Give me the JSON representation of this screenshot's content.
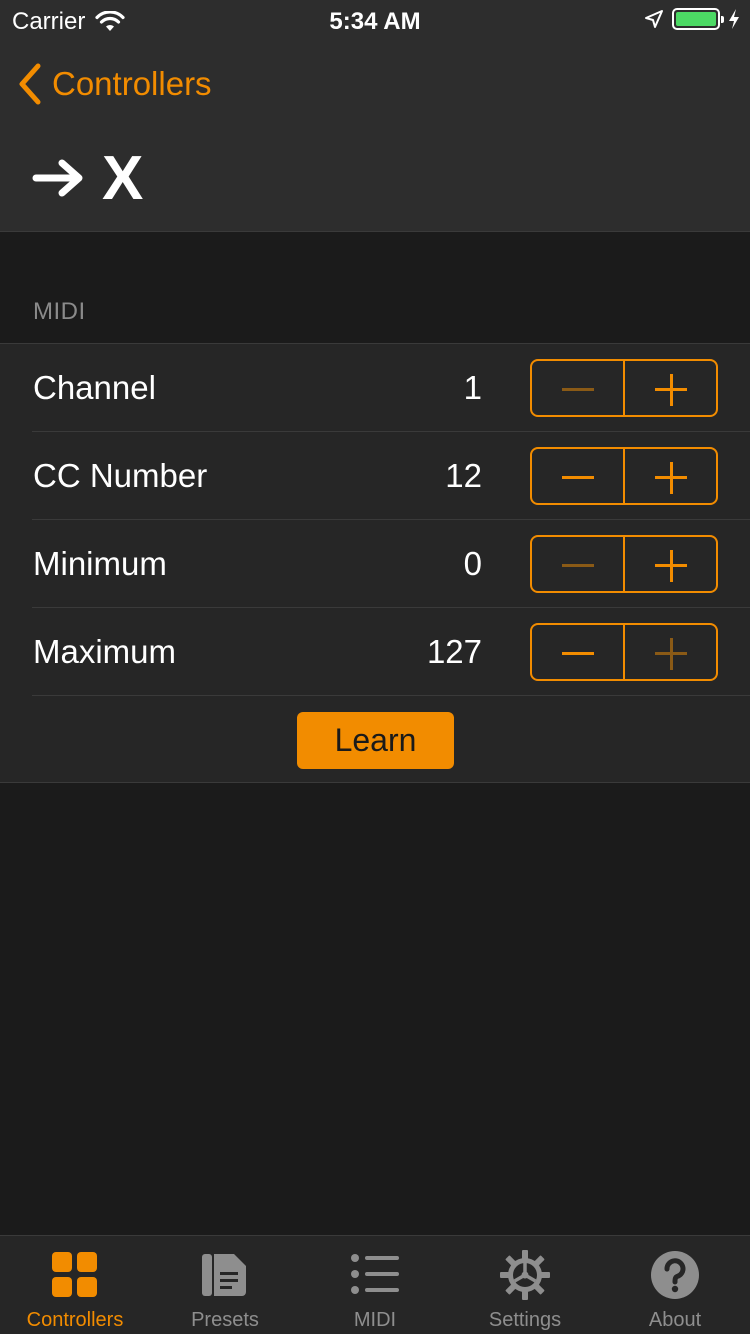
{
  "status_bar": {
    "carrier": "Carrier",
    "time": "5:34 AM"
  },
  "nav": {
    "back_label": "Controllers",
    "title": "X"
  },
  "section": {
    "header": "MIDI"
  },
  "rows": [
    {
      "label": "Channel",
      "value": "1",
      "minus_enabled": false,
      "plus_enabled": true
    },
    {
      "label": "CC Number",
      "value": "12",
      "minus_enabled": true,
      "plus_enabled": true
    },
    {
      "label": "Minimum",
      "value": "0",
      "minus_enabled": false,
      "plus_enabled": true
    },
    {
      "label": "Maximum",
      "value": "127",
      "minus_enabled": true,
      "plus_enabled": false
    }
  ],
  "learn_button": {
    "label": "Learn"
  },
  "tabs": [
    {
      "label": "Controllers",
      "icon": "grid-icon",
      "active": true
    },
    {
      "label": "Presets",
      "icon": "document-icon",
      "active": false
    },
    {
      "label": "MIDI",
      "icon": "list-icon",
      "active": false
    },
    {
      "label": "Settings",
      "icon": "gear-icon",
      "active": false
    },
    {
      "label": "About",
      "icon": "question-icon",
      "active": false
    }
  ],
  "colors": {
    "accent": "#f28c00",
    "background": "#1b1b1b",
    "header_background": "#2d2d2d",
    "battery": "#4cd964"
  }
}
